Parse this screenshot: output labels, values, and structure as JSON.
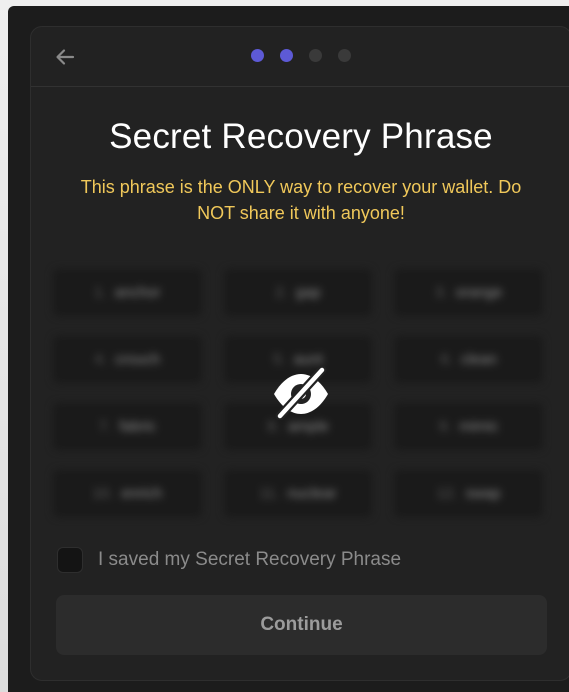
{
  "onboarding": {
    "title": "Secret Recovery Phrase",
    "warning": "This phrase is the ONLY way to recover your wallet. Do NOT share it with anyone!",
    "steps": {
      "total": 4,
      "completed": 2
    },
    "phrase_words": [
      {
        "num": "1.",
        "word": "anchor"
      },
      {
        "num": "2.",
        "word": "gap"
      },
      {
        "num": "3.",
        "word": "orange"
      },
      {
        "num": "4.",
        "word": "crouch"
      },
      {
        "num": "5.",
        "word": "aunt"
      },
      {
        "num": "6.",
        "word": "clean"
      },
      {
        "num": "7.",
        "word": "fabric"
      },
      {
        "num": "8.",
        "word": "ample"
      },
      {
        "num": "9.",
        "word": "mimic"
      },
      {
        "num": "10.",
        "word": "enrich"
      },
      {
        "num": "11.",
        "word": "nuclear"
      },
      {
        "num": "12.",
        "word": "swap"
      }
    ],
    "phrase_hidden": true,
    "checkbox_label": "I saved my Secret Recovery Phrase",
    "checkbox_checked": false,
    "continue_label": "Continue"
  },
  "colors": {
    "accent": "#5d5ad6",
    "warning": "#f0c85a",
    "card": "#222222",
    "background": "#1c1c1c"
  },
  "icons": {
    "back": "arrow-left-icon",
    "reveal": "eye-slash-icon"
  }
}
